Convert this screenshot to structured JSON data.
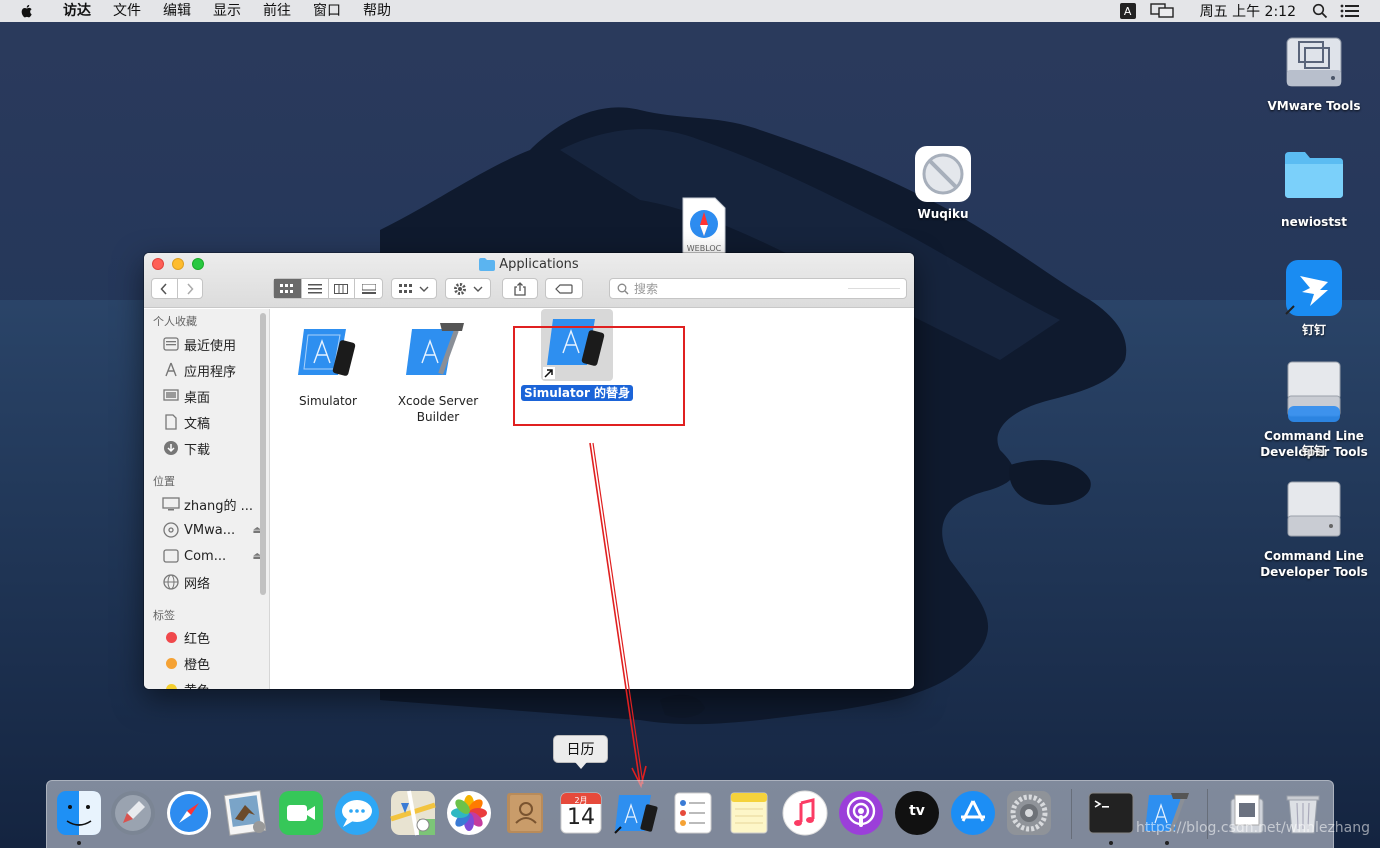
{
  "menubar": {
    "items": [
      "访达",
      "文件",
      "编辑",
      "显示",
      "前往",
      "窗口",
      "帮助"
    ],
    "input_method": "A",
    "clock": "周五 上午 2:12"
  },
  "desktop_icons": {
    "vmware_tools": "VMware Tools",
    "wuqiku": "Wuqiku",
    "webloc_badge": "WEBLOC",
    "newiostst": "newiostst",
    "dingding": "钉钉",
    "cmd_tools_1": "Command Line\nDeveloper Tools",
    "cmd_tools_1_overlay": "钉钉",
    "cmd_tools_2": "Command Line\nDeveloper Tools"
  },
  "finder": {
    "title": "Applications",
    "search_placeholder": "搜索",
    "sidebar": {
      "favorites_header": "个人收藏",
      "favorites": [
        "最近使用",
        "应用程序",
        "桌面",
        "文稿",
        "下载"
      ],
      "locations_header": "位置",
      "locations": [
        "zhang的 ...",
        "VMwa...",
        "Com...",
        "网络"
      ],
      "tags_header": "标签",
      "tags": [
        {
          "label": "红色",
          "color": "#f0484b"
        },
        {
          "label": "橙色",
          "color": "#f5a234"
        },
        {
          "label": "黄色",
          "color": "#f4cf2f"
        }
      ]
    },
    "files": [
      {
        "label": "Simulator"
      },
      {
        "label": "Xcode Server\nBuilder"
      },
      {
        "label": "Simulator 的替身"
      }
    ]
  },
  "dock": {
    "tooltip": "日历",
    "calendar_month": "2月",
    "calendar_day": "14",
    "appletv_label": "tv"
  },
  "watermark": "https://blog.csdn.net/wnnlezhang",
  "colors": {
    "selection": "#1b64d8",
    "annotation": "#e02020"
  }
}
